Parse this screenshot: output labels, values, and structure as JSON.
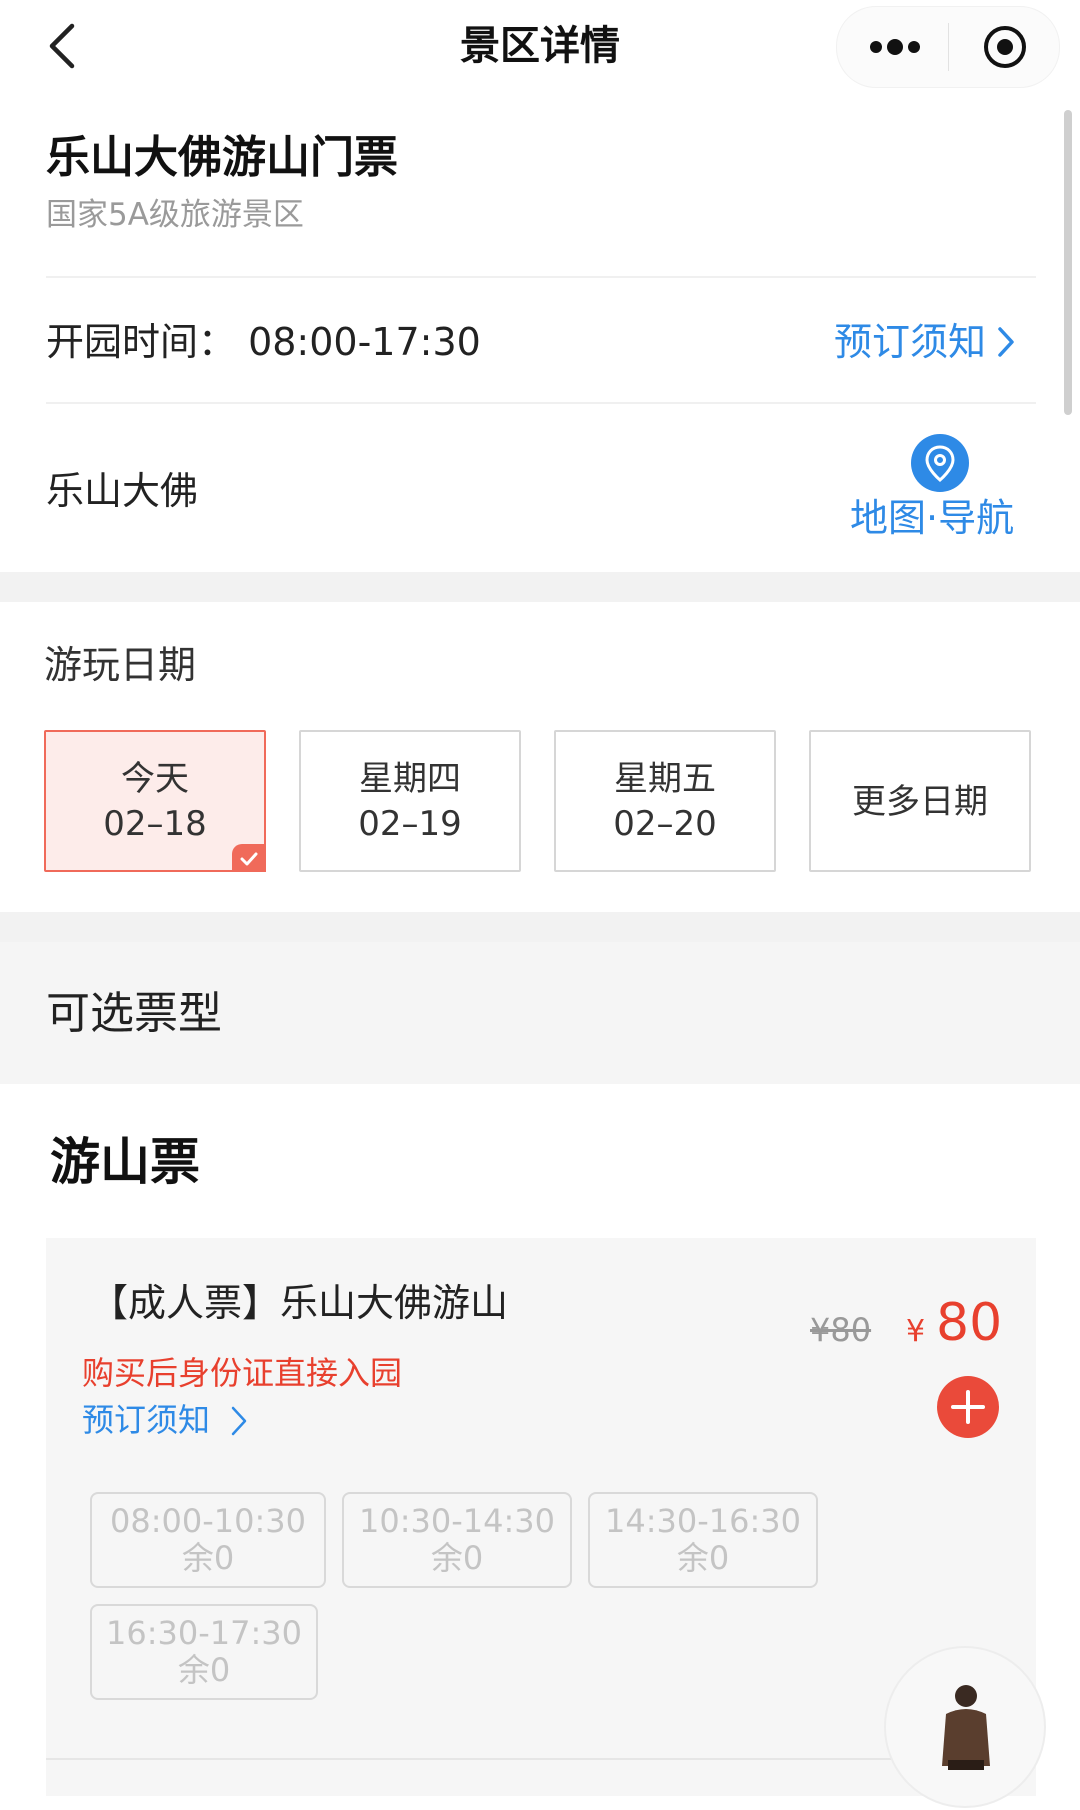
{
  "nav": {
    "title": "景区详情"
  },
  "header": {
    "title": "乐山大佛游山门票",
    "subtitle": "国家5A级旅游景区"
  },
  "info": {
    "open_time": "开园时间：  08:00-17:30",
    "notice_link": "预订须知",
    "place_name": "乐山大佛",
    "map_label": "地图·导航"
  },
  "dates": {
    "label": "游玩日期",
    "items": [
      {
        "l1": "今天",
        "l2": "02–18",
        "selected": true
      },
      {
        "l1": "星期四",
        "l2": "02–19",
        "selected": false
      },
      {
        "l1": "星期五",
        "l2": "02–20",
        "selected": false
      }
    ],
    "more": "更多日期"
  },
  "section": {
    "label": "可选票型"
  },
  "ticket_group": {
    "title": "游山票"
  },
  "ticket": {
    "name": "【成人票】乐山大佛游山",
    "warning": "购买后身份证直接入园",
    "notice": "预订须知",
    "old_price": "¥80",
    "currency": "¥",
    "price": "80",
    "slots": [
      {
        "time": "08:00-10:30",
        "remain": "余0"
      },
      {
        "time": "10:30-14:30",
        "remain": "余0"
      },
      {
        "time": "14:30-16:30",
        "remain": "余0"
      },
      {
        "time": "16:30-17:30",
        "remain": "余0"
      }
    ]
  },
  "colors": {
    "accent_blue": "#2e8ae6",
    "accent_red": "#e8402e",
    "selected_bg": "#fdecea"
  },
  "icons": [
    "back-arrow-icon",
    "more-dots-icon",
    "target-icon",
    "chevron-right-icon",
    "location-pin-icon",
    "check-icon",
    "plus-icon",
    "avatar"
  ]
}
